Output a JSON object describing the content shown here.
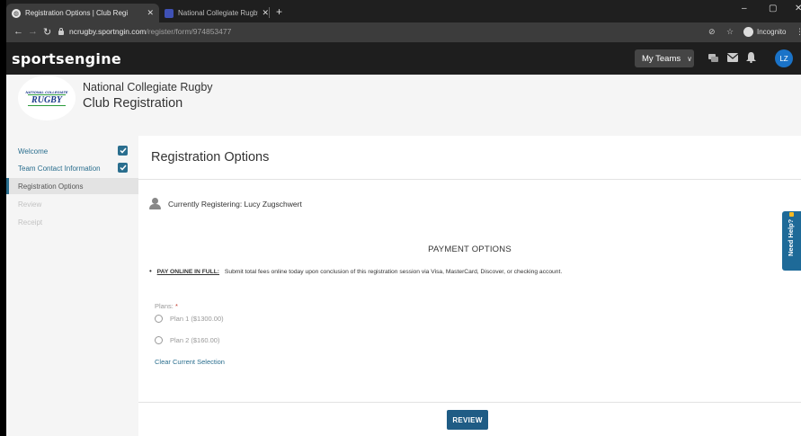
{
  "browser": {
    "tabs": [
      {
        "label": "Registration Options | Club Regi",
        "close": "✕",
        "icon": "globe-icon"
      },
      {
        "label": "National Collegiate Rugby",
        "close": "✕",
        "icon": "page-icon"
      }
    ],
    "new_tab": "+",
    "window_controls": {
      "minimize": "–",
      "restore": "▢",
      "close": "✕"
    },
    "url_host": "ncrugby.sportngin.com",
    "url_path": "/register/form/974853477",
    "incognito_label": "Incognito"
  },
  "app": {
    "logo": "sportsengine",
    "my_teams": "My Teams",
    "avatar_initials": "LZ",
    "icons": [
      "chat-icon",
      "mail-icon",
      "bell-icon"
    ]
  },
  "org": {
    "logo_top": "NATIONAL COLLEGIATE",
    "logo_main": "RUGBY",
    "name": "National Collegiate Rugby",
    "subtitle": "Club Registration"
  },
  "sidebar": {
    "items": [
      {
        "label": "Welcome",
        "state": "done"
      },
      {
        "label": "Team Contact Information",
        "state": "done"
      },
      {
        "label": "Registration Options",
        "state": "current"
      },
      {
        "label": "Review",
        "state": "disabled"
      },
      {
        "label": "Receipt",
        "state": "disabled"
      }
    ]
  },
  "main": {
    "title": "Registration Options",
    "registering": "Currently Registering: Lucy Zugschwert",
    "payment_title": "PAYMENT OPTIONS",
    "payment_key": "PAY ONLINE IN FULL:",
    "payment_desc": "Submit total fees online today upon conclusion of this registration session via Visa, MasterCard, Discover, or checking account.",
    "plans_label": "Plans:",
    "required_mark": "*",
    "plans": [
      {
        "label": "Plan 1 ($1300.00)"
      },
      {
        "label": "Plan 2 ($160.00)"
      }
    ],
    "clear_selection": "Clear Current Selection",
    "review_button": "REVIEW",
    "need_help": "Need Help?"
  },
  "colors": {
    "accent": "#2a6e8e",
    "review_button": "#1f5c85",
    "avatar": "#1a73c8",
    "help_tab": "#1e6a98"
  }
}
